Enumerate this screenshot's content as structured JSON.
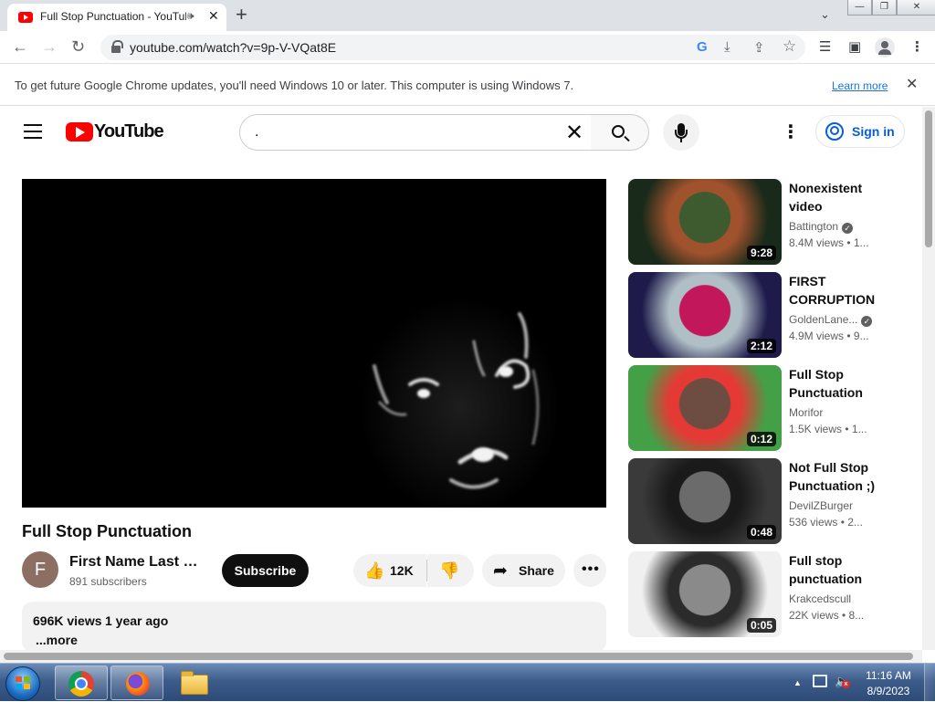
{
  "browser": {
    "tab": {
      "title": "Full Stop Punctuation - YouTube",
      "speaker_glyph": "🕪",
      "close_glyph": "✕"
    },
    "new_tab_glyph": "+",
    "tab_menu_glyph": "⌄",
    "window_controls": {
      "minimize": "—",
      "restore": "❐",
      "close": "✕"
    },
    "nav": {
      "back": "←",
      "forward": "→",
      "reload": "↻"
    },
    "url": "youtube.com/watch?v=9p-V-VQat8E",
    "toolbar_icons": {
      "google": "G",
      "install": "⤓",
      "share": "⇪",
      "bookmark": "☆",
      "media": "☰",
      "sidepanel": "▣",
      "menu": "⋮"
    }
  },
  "infobar": {
    "message": "To get future Google Chrome updates, you'll need Windows 10 or later. This computer is using Windows 7.",
    "link": "Learn more",
    "close_glyph": "✕"
  },
  "masthead": {
    "logo_text": "YouTube",
    "search": {
      "query": ".",
      "clear_glyph": "✕"
    },
    "menu_glyph": "⋮",
    "sign_in": "Sign in"
  },
  "video": {
    "title": "Full Stop Punctuation",
    "owner": {
      "initial": "F",
      "name": "First Name Last N...",
      "subscribers": "891 subscribers",
      "avatar_color": "#8d6e63"
    },
    "subscribe": "Subscribe",
    "likes": "12K",
    "like_glyph": "👍",
    "dislike_glyph": "👎",
    "share": "Share",
    "share_glyph": "➦",
    "more_glyph": "•••",
    "views": "696K views",
    "date": "1 year ago",
    "more_link": "...more"
  },
  "recommendations": [
    {
      "title": "Nonexistent video",
      "channel": "Battington",
      "verified": true,
      "meta": "8.4M views • 1...",
      "duration": "9:28",
      "thumb_colors": [
        "#1a2a1a",
        "#3d5b2e",
        "#a0522d"
      ]
    },
    {
      "title": "FIRST CORRUPTION ...",
      "channel": "GoldenLane...",
      "verified": true,
      "meta": "4.9M views • 9...",
      "duration": "2:12",
      "thumb_colors": [
        "#1e1b4b",
        "#c2185b",
        "#b0bec5"
      ]
    },
    {
      "title": "Full Stop Punctuation",
      "channel": "Morifor",
      "verified": false,
      "meta": "1.5K views • 1...",
      "duration": "0:12",
      "thumb_colors": [
        "#43a047",
        "#6d4c41",
        "#e53935"
      ]
    },
    {
      "title": "Not Full Stop Punctuation ;)",
      "channel": "DevilZBurger",
      "verified": false,
      "meta": "536 views • 2...",
      "duration": "0:48",
      "thumb_colors": [
        "#3a3a3a",
        "#6b6b6b",
        "#1a1a1a"
      ]
    },
    {
      "title": "Full stop punctuation",
      "channel": "Krakcedscull",
      "verified": false,
      "meta": "22K views • 8...",
      "duration": "0:05",
      "thumb_colors": [
        "#f0f0f0",
        "#8a8a8a",
        "#2b2b2b"
      ]
    }
  ],
  "taskbar": {
    "apps": [
      "chrome-icon",
      "firefox-icon",
      "file-explorer-icon"
    ],
    "tray_arrow": "▲",
    "volume_glyph": "🔈",
    "volume_muted": "x",
    "time": "11:16 AM",
    "date": "8/9/2023"
  }
}
